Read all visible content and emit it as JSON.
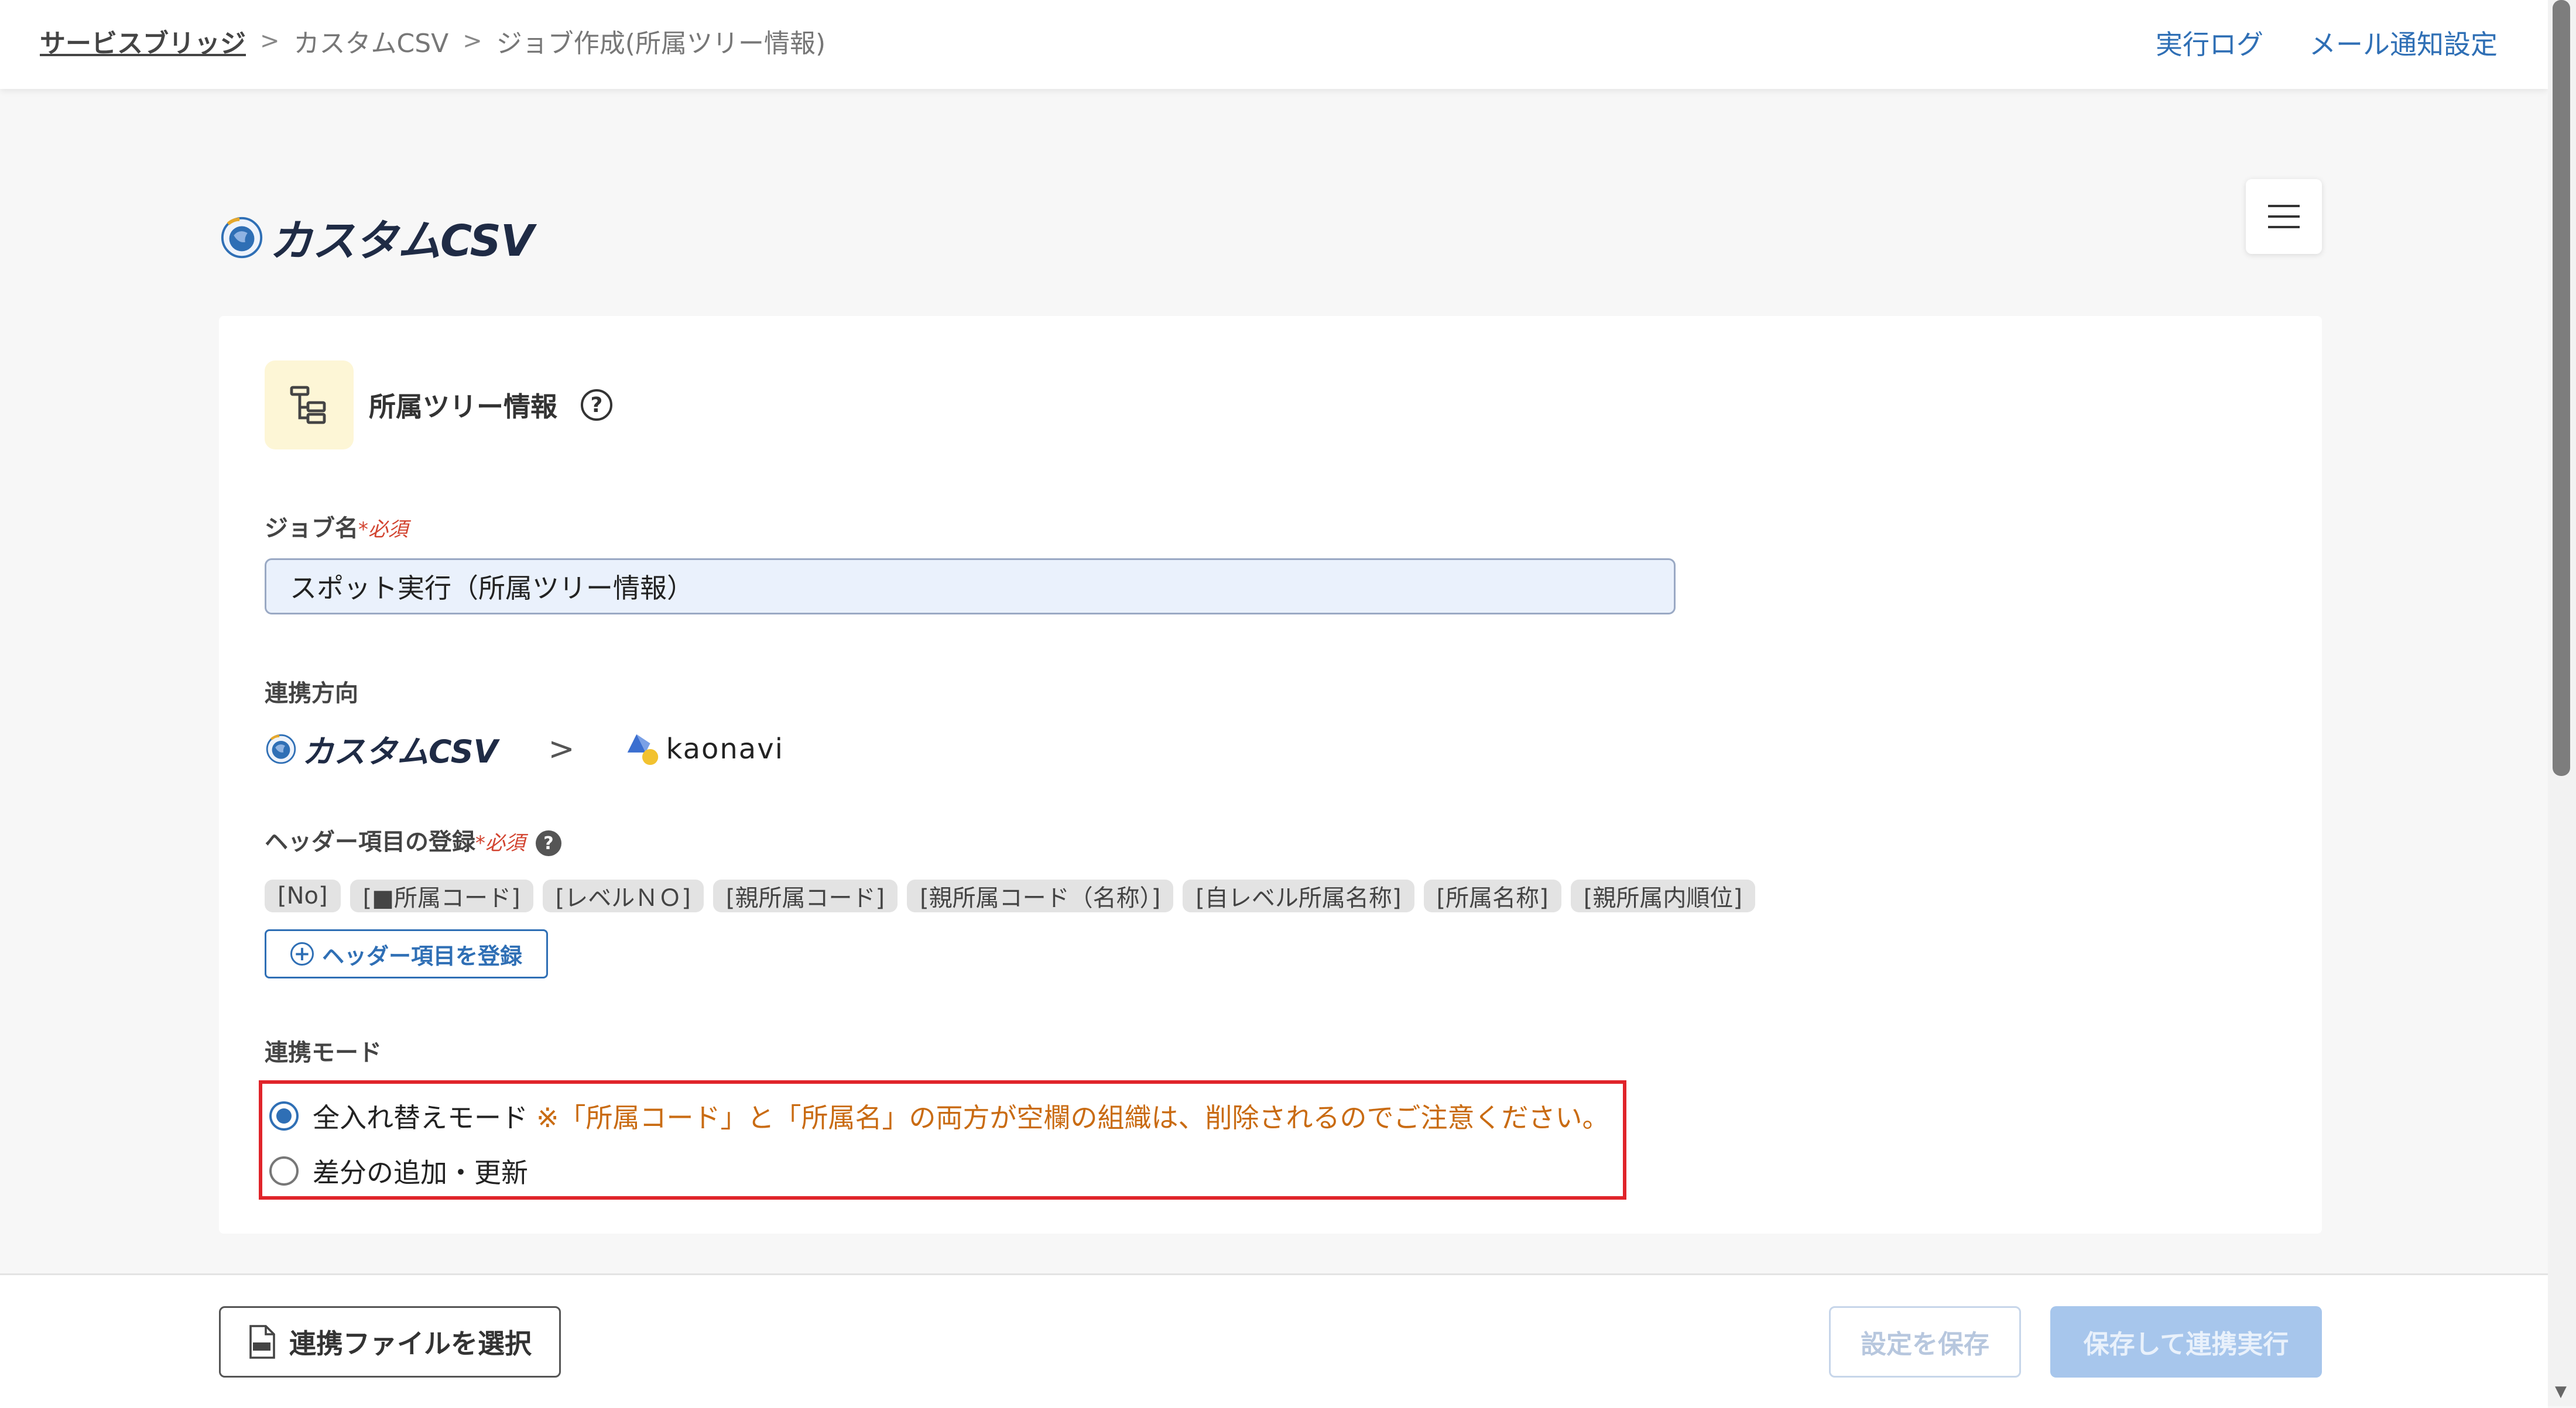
{
  "breadcrumb": {
    "root": "サービスブリッジ",
    "items": [
      "カスタムCSV",
      "ジョブ作成(所属ツリー情報)"
    ],
    "separator": ">"
  },
  "header_links": {
    "run_log": "実行ログ",
    "mail_settings": "メール通知設定"
  },
  "brand": {
    "name": "カスタムCSV"
  },
  "menu": {
    "icon": "hamburger-icon",
    "glyph": "☰"
  },
  "job_type": {
    "label": "所属ツリー情報",
    "help_glyph": "?"
  },
  "job_name": {
    "label": "ジョブ名",
    "required_star": "*",
    "required_text": "必須",
    "value": "スポット実行（所属ツリー情報）"
  },
  "direction": {
    "label": "連携方向",
    "from": "カスタムCSV",
    "arrow": ">",
    "to": "kaonavi"
  },
  "headers": {
    "label": "ヘッダー項目の登録",
    "required_star": "*",
    "required_text": "必須",
    "help_glyph": "?",
    "items": [
      "[No]",
      "[■所属コード]",
      "[レベルＮＯ]",
      "[親所属コード]",
      "[親所属コード（名称）]",
      "[自レベル所属名称]",
      "[所属名称]",
      "[親所属内順位]"
    ],
    "add_button": "ヘッダー項目を登録"
  },
  "mode": {
    "label": "連携モード",
    "options": [
      {
        "label": "全入れ替えモード",
        "note": "※「所属コード」と「所属名」の両方が空欄の組織は、削除されるのでご注意ください。",
        "selected": true
      },
      {
        "label": "差分の追加・更新",
        "note": "",
        "selected": false
      }
    ]
  },
  "footer": {
    "select_file": "連携ファイルを選択",
    "save": "設定を保存",
    "save_and_run": "保存して連携実行"
  },
  "colors": {
    "accent": "#2f6fb5",
    "required": "#d2432f",
    "warning": "#c96b12",
    "highlight_border": "#e0242a",
    "disabled_button": "#a7c6ec"
  }
}
